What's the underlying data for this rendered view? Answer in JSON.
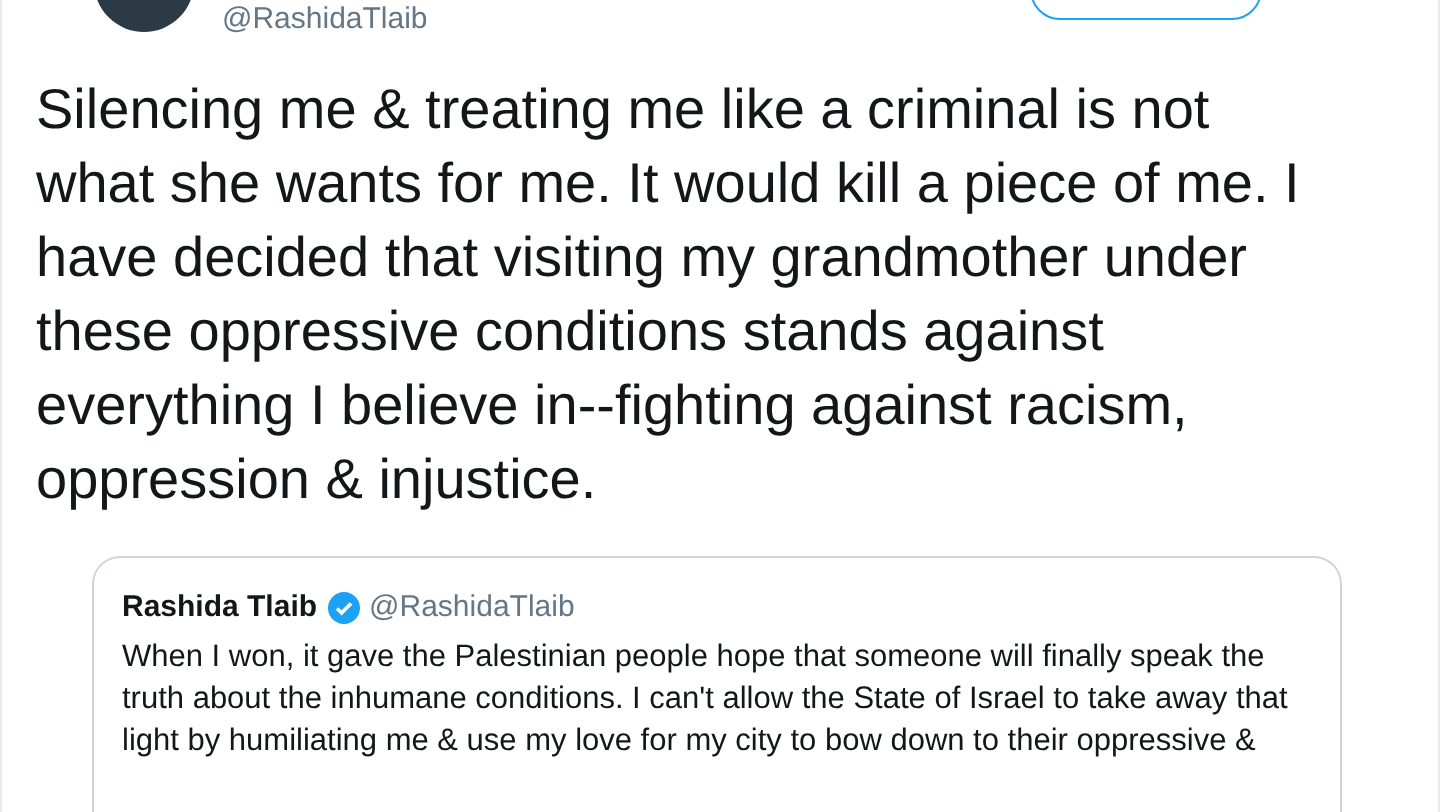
{
  "tweet": {
    "handle": "@RashidaTlaib",
    "text": "Silencing me & treating me like a criminal is not what she wants for me. It would kill a piece of me. I have decided that visiting my grandmother under these oppressive conditions stands against everything I believe in--fighting against racism, oppression & injustice.",
    "quoted": {
      "name": "Rashida Tlaib",
      "verified": true,
      "handle": "@RashidaTlaib",
      "text": "When I won, it gave the Palestinian people hope that someone will finally speak the truth about the inhumane conditions. I can't allow the State of Israel to take away that light by humiliating me & use my love for my city to bow down to their oppressive &"
    }
  }
}
